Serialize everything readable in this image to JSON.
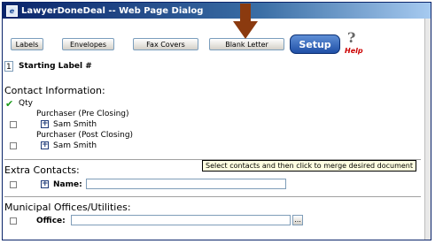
{
  "window": {
    "title": "LawyerDoneDeal -- Web Page Dialog"
  },
  "toolbar": {
    "buttons": [
      "Labels",
      "Envelopes",
      "Fax Covers",
      "Blank Letter"
    ],
    "setup_label": "Setup",
    "help_label": "Help"
  },
  "labels": {
    "starting_value": "1",
    "starting_label": "Starting Label #"
  },
  "contact_info": {
    "heading": "Contact Information:",
    "qty_label": "Qty",
    "groups": [
      {
        "title": "Purchaser (Pre Closing)",
        "person": "Sam Smith"
      },
      {
        "title": "Purchaser (Post Closing)",
        "person": "Sam Smith"
      }
    ]
  },
  "tooltip": "Select contacts and then click to merge desired document",
  "extra_contacts": {
    "heading": "Extra Contacts:",
    "name_label": "Name:"
  },
  "municipal": {
    "heading": "Municipal Offices/Utilities:",
    "office_label": "Office:",
    "ellipsis": "..."
  },
  "colors": {
    "title_bar": "#0a246a",
    "setup": "#1f4fa6",
    "arrow": "#8b3a0f",
    "check": "#1a9a1a",
    "help_text": "#cc0000"
  }
}
